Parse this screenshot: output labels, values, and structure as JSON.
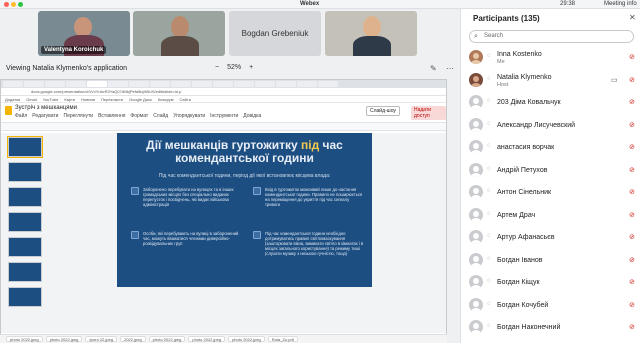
{
  "window": {
    "title": "Webex",
    "clock": "29:38",
    "meeting_info": "Meeting info"
  },
  "video_tiles": [
    {
      "name": "Valentyna Koroichuk"
    },
    {
      "name": ""
    },
    {
      "name": "Bogdan Grebeniuk"
    },
    {
      "name": ""
    }
  ],
  "share_bar": {
    "label": "Viewing Natalia Klymenko's application",
    "zoom": "52%",
    "zoom_minus": "−",
    "zoom_plus": "+"
  },
  "browser": {
    "address": "docs.google.com/presentation/d/1VxYrAeR3YaQ07dNkjPefa5lqHBUS/edit#slide=id.p",
    "bookmarks": [
      "Додатки",
      "Gmail",
      "YouTube",
      "Карти",
      "Новини",
      "Перекласти",
      "Google Диск",
      "Класрум",
      "Сайти"
    ]
  },
  "slides_app": {
    "doc_title": "Зустріч з мешканцями",
    "menu": [
      "Файл",
      "Редагувати",
      "Переглянути",
      "Вставлення",
      "Формат",
      "Слайд",
      "Упорядкувати",
      "Інструменти",
      "Довідка"
    ],
    "present_label": "Слайд-шоу",
    "access_label": "Надати доступ"
  },
  "slide": {
    "title_part1": "Дії мешканців гуртожитку ",
    "title_highlight": "під",
    "title_part2": " час комендантської години",
    "subtitle": "Під час комендантської години, період дії якої встановлює місцева влада:",
    "blocks": [
      {
        "text": "Заборонено перебувати на вулицях та в інших громадських місцях без спеціально виданих перепусток і посвідчень, які видає військова адміністрація"
      },
      {
        "text": "Вхід в гуртожиток можливий лише до настання комендантської години. Правило не поширюється на переміщення до укриття під час сигналу тривоги"
      },
      {
        "text": "Особи, які перебувають на вулиці в заборонений час, можуть вважатися членами диверсійно-розвідувальних груп"
      },
      {
        "text": "Під час комендантської години необхідно дотримуватись правил світломаскування (зашторювати вікна, вимикати світло в кімнатах і в місцях загального користування) та режиму тиші (слухати музику з низькою гучністю, тощо)"
      }
    ]
  },
  "notes": "Натисніть, щоб додати нотатки доповідача",
  "taskbar_items": [
    "photo 2022.jpeg",
    "photo 2022.jpeg",
    "фото 22.jpeg",
    "2022.jpeg",
    "photo 2022.jpeg",
    "photo 2022.jpeg",
    "photo 2022.jpeg",
    "Ruta_Zu.pdf"
  ],
  "participants": {
    "header": "Participants (135)",
    "search_placeholder": "Search",
    "list": [
      {
        "name": "Inna Kostenko",
        "role": "Me"
      },
      {
        "name": "Natalia Klymenko",
        "role": "Host"
      },
      {
        "name": "203 Діма Ковальчук",
        "role": ""
      },
      {
        "name": "Александр Лисучевский",
        "role": ""
      },
      {
        "name": "анастасия ворчак",
        "role": ""
      },
      {
        "name": "Андрій Петухов",
        "role": ""
      },
      {
        "name": "Антон Сінельник",
        "role": ""
      },
      {
        "name": "Артем Драч",
        "role": ""
      },
      {
        "name": "Артур Афанасьєв",
        "role": ""
      },
      {
        "name": "Богдан Іванов",
        "role": ""
      },
      {
        "name": "Богдан Кіщук",
        "role": ""
      },
      {
        "name": "Богдан Кочубей",
        "role": ""
      },
      {
        "name": "Богдан Наконечний",
        "role": ""
      }
    ]
  }
}
